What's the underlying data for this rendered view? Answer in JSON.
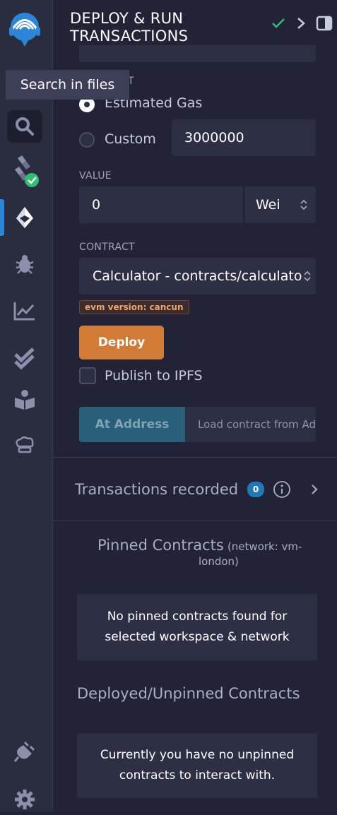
{
  "rail": {
    "tooltip": "Search in files",
    "icons": [
      "remix-logo-icon",
      "file-explorer-icon",
      "search-icon",
      "solidity-compiler-icon",
      "deploy-run-icon",
      "debugger-icon",
      "analytics-icon",
      "unit-testing-icon",
      "learneth-icon",
      "chef-icon",
      "plugin-manager-icon",
      "settings-icon"
    ]
  },
  "header": {
    "title_line1": "DEPLOY & RUN",
    "title_line2": "TRANSACTIONS"
  },
  "gas": {
    "label_partial": "T",
    "estimated_label": "Estimated Gas",
    "custom_label": "Custom",
    "custom_value": "3000000"
  },
  "value": {
    "label": "VALUE",
    "amount": "0",
    "unit": "Wei"
  },
  "contract": {
    "label": "CONTRACT",
    "selected": "Calculator - contracts/calculator",
    "evm_badge": "evm version: cancun"
  },
  "deploy": {
    "button": "Deploy",
    "publish_label": "Publish to IPFS"
  },
  "at_address": {
    "button": "At Address",
    "placeholder": "Load contract from Ad"
  },
  "transactions": {
    "label": "Transactions recorded",
    "count": "0"
  },
  "pinned": {
    "title": "Pinned Contracts",
    "network_line1": "(network: vm-",
    "network_line2": "london)",
    "empty_line1": "No pinned contracts found for",
    "empty_line2": "selected workspace & network"
  },
  "deployed": {
    "title": "Deployed/Unpinned Contracts",
    "empty_line1": "Currently you have no unpinned",
    "empty_line2": "contracts to interact with."
  },
  "colors": {
    "accent": "#2b86d8",
    "deploy": "#d27b36",
    "check": "#2fbf71"
  }
}
